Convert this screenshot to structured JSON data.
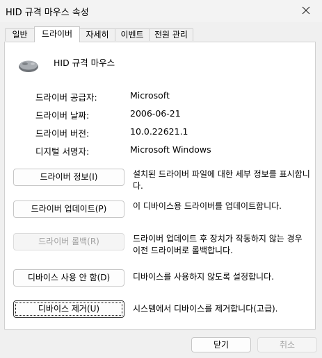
{
  "window": {
    "title": "HID 규격 마우스 속성"
  },
  "tabs": [
    {
      "label": "일반"
    },
    {
      "label": "드라이버"
    },
    {
      "label": "자세히"
    },
    {
      "label": "이벤트"
    },
    {
      "label": "전원 관리"
    }
  ],
  "active_tab": "드라이버",
  "device": {
    "name": "HID 규격 마우스",
    "icon": "mouse-icon"
  },
  "info": [
    {
      "label": "드라이버 공급자:",
      "value": "Microsoft"
    },
    {
      "label": "드라이버 날짜:",
      "value": "2006-06-21"
    },
    {
      "label": "드라이버 버전:",
      "value": "10.0.22621.1"
    },
    {
      "label": "디지털 서명자:",
      "value": "Microsoft Windows"
    }
  ],
  "actions": [
    {
      "button": "드라이버 정보(I)",
      "description": "설치된 드라이버 파일에 대한 세부 정보를 표시합니다."
    },
    {
      "button": "드라이버 업데이트(P)",
      "description": "이 디바이스용 드라이버를 업데이트합니다."
    },
    {
      "button": "드라이버 롤백(R)",
      "description": "드라이버 업데이트 후 장치가 작동하지 않는 경우 이전 드라이버로 롤백합니다."
    },
    {
      "button": "디바이스 사용 안 함(D)",
      "description": "디바이스를 사용하지 않도록 설정합니다."
    },
    {
      "button": "디바이스 제거(U)",
      "description": "시스템에서 디바이스를 제거합니다(고급)."
    }
  ],
  "footer": {
    "ok_label": "닫기",
    "cancel_label": "취소"
  },
  "colors": {
    "background": "#f0f0f0",
    "panel": "#ffffff",
    "disabled_text": "#a0a0a0"
  }
}
